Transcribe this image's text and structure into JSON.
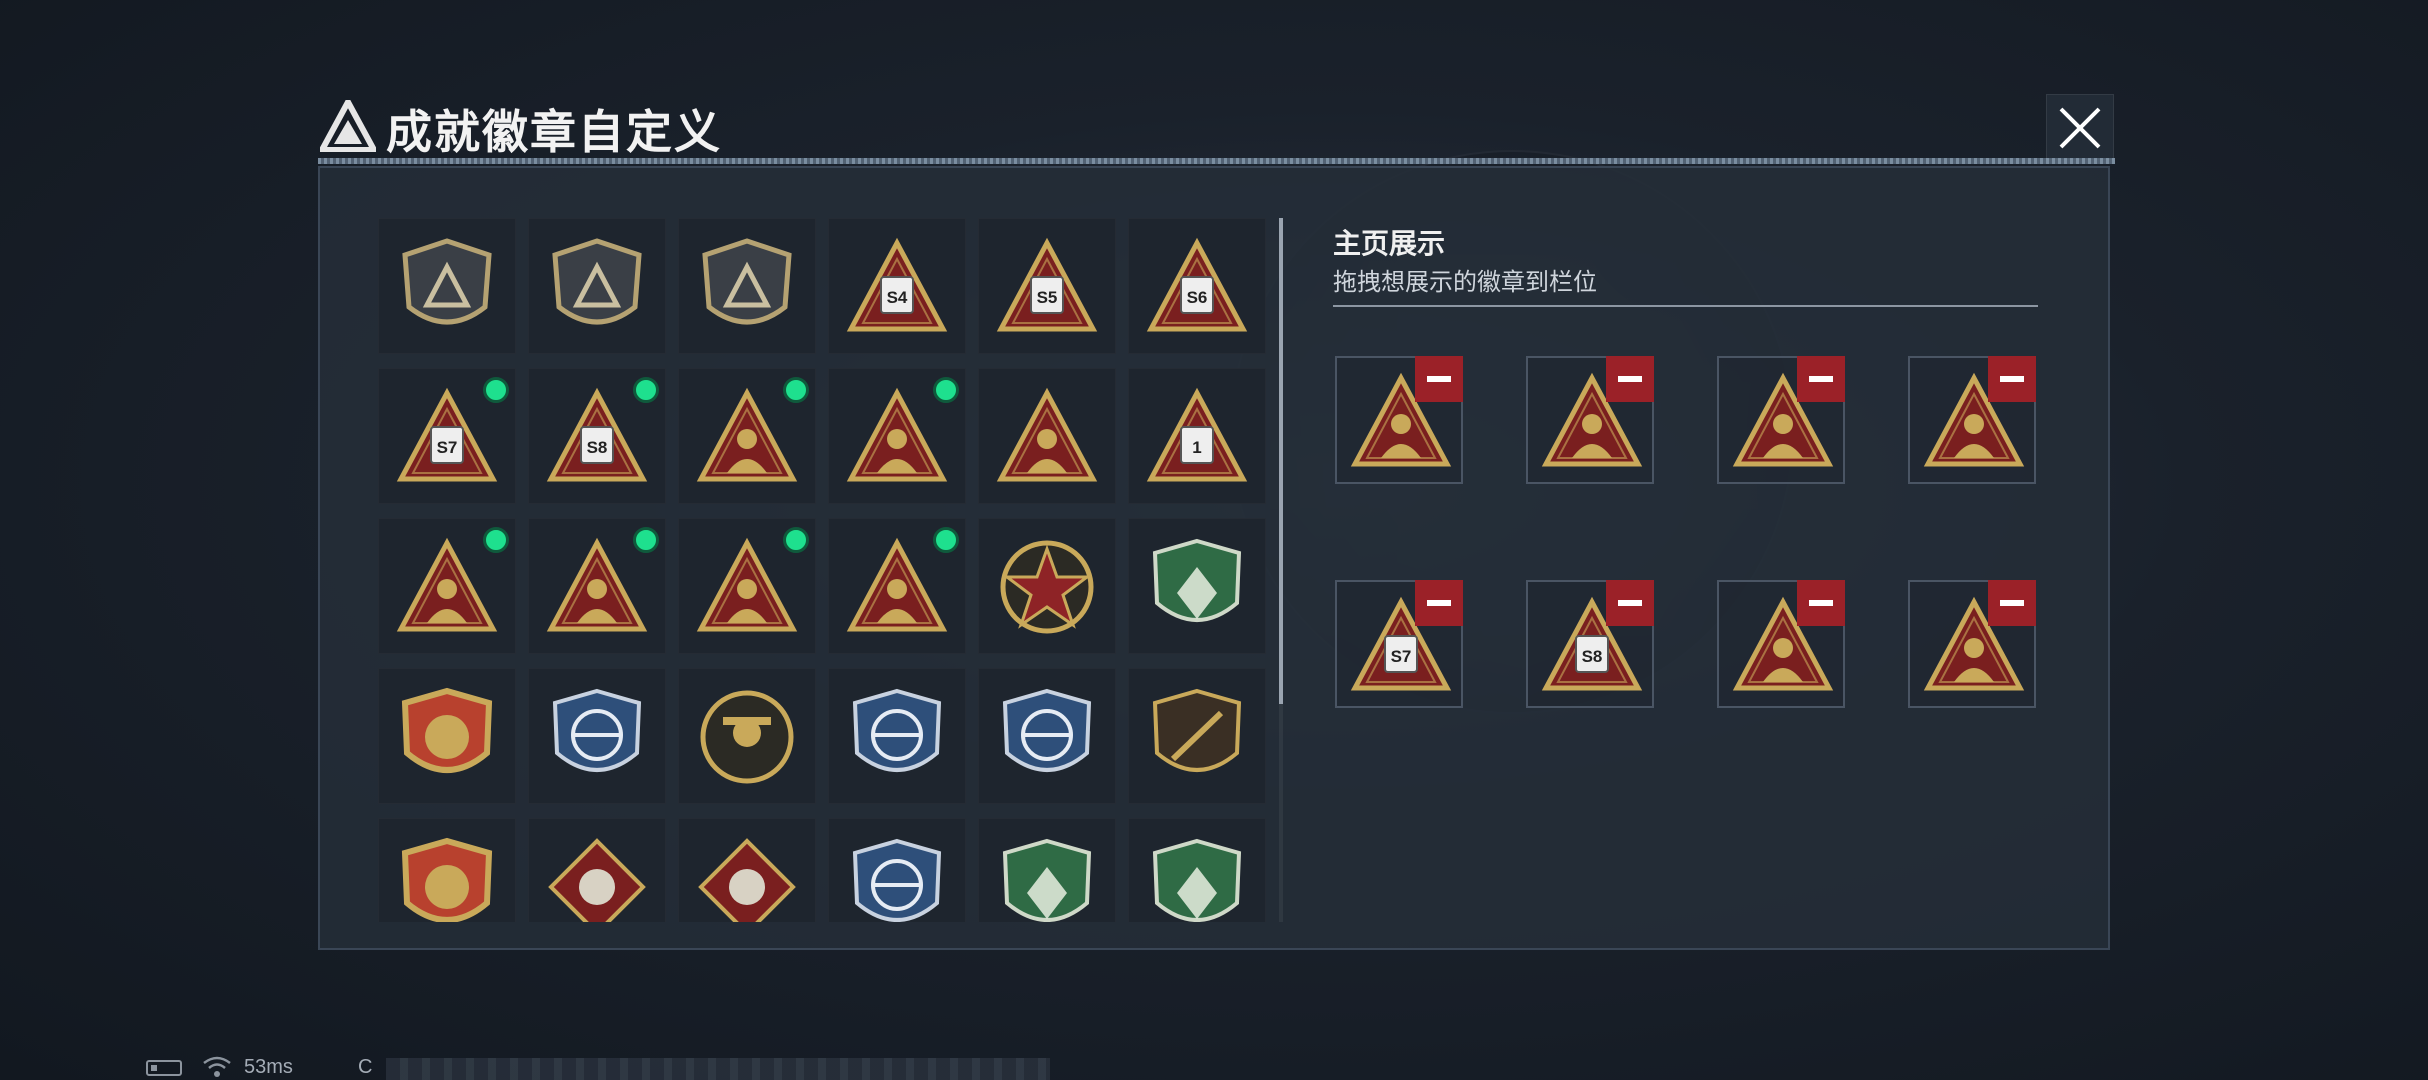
{
  "window": {
    "title": "成就徽章自定义",
    "close_label": "✕"
  },
  "display": {
    "title": "主页展示",
    "subtitle": "拖拽想展示的徽章到栏位",
    "slots": [
      {
        "badge": "tri-usb"
      },
      {
        "badge": "tri-woman"
      },
      {
        "badge": "tri-helmet"
      },
      {
        "badge": "tri-group"
      },
      {
        "badge": "tri-s7"
      },
      {
        "badge": "tri-s8"
      },
      {
        "badge": "tri-dancer"
      },
      {
        "badge": "tri-dice"
      }
    ]
  },
  "grid": {
    "rows": [
      [
        {
          "badge": "shield-logo",
          "new": false
        },
        {
          "badge": "shield-heli",
          "new": false
        },
        {
          "badge": "shield-diamond",
          "new": false
        },
        {
          "badge": "tri-s4",
          "label": "S4",
          "new": false
        },
        {
          "badge": "tri-s5",
          "label": "S5",
          "new": false
        },
        {
          "badge": "tri-s6",
          "label": "S6",
          "new": false
        }
      ],
      [
        {
          "badge": "tri-s7",
          "label": "S7",
          "new": true
        },
        {
          "badge": "tri-s8",
          "label": "S8",
          "new": true
        },
        {
          "badge": "tri-woman",
          "new": true
        },
        {
          "badge": "tri-helmet",
          "new": true
        },
        {
          "badge": "tri-bowl",
          "new": false
        },
        {
          "badge": "tri-one",
          "label": "1",
          "new": false
        }
      ],
      [
        {
          "badge": "tri-usb",
          "new": true
        },
        {
          "badge": "tri-dancer",
          "new": true
        },
        {
          "badge": "tri-dice",
          "new": true
        },
        {
          "badge": "tri-group",
          "new": true
        },
        {
          "badge": "round-star",
          "new": false
        },
        {
          "badge": "green-crest",
          "new": false
        }
      ],
      [
        {
          "badge": "gold-crest",
          "new": false
        },
        {
          "badge": "blue-crest",
          "new": false
        },
        {
          "badge": "round-cowboy",
          "new": false
        },
        {
          "badge": "blue-rifle",
          "new": false
        },
        {
          "badge": "blue-rifle-2",
          "new": false
        },
        {
          "badge": "dark-rifle",
          "new": false
        }
      ],
      [
        {
          "badge": "gold-cross",
          "new": false
        },
        {
          "badge": "red-wolf",
          "new": false
        },
        {
          "badge": "red-wolf-2",
          "new": false
        },
        {
          "badge": "blue-eagle",
          "new": false
        },
        {
          "badge": "green-bee",
          "new": false
        },
        {
          "badge": "green-medic",
          "new": false
        }
      ]
    ]
  },
  "statusbar": {
    "ping": "53ms",
    "id_prefix": "C"
  },
  "colors": {
    "accent_red": "#9b2128",
    "new_dot": "#1ee08e",
    "gold": "#c9a95a"
  }
}
